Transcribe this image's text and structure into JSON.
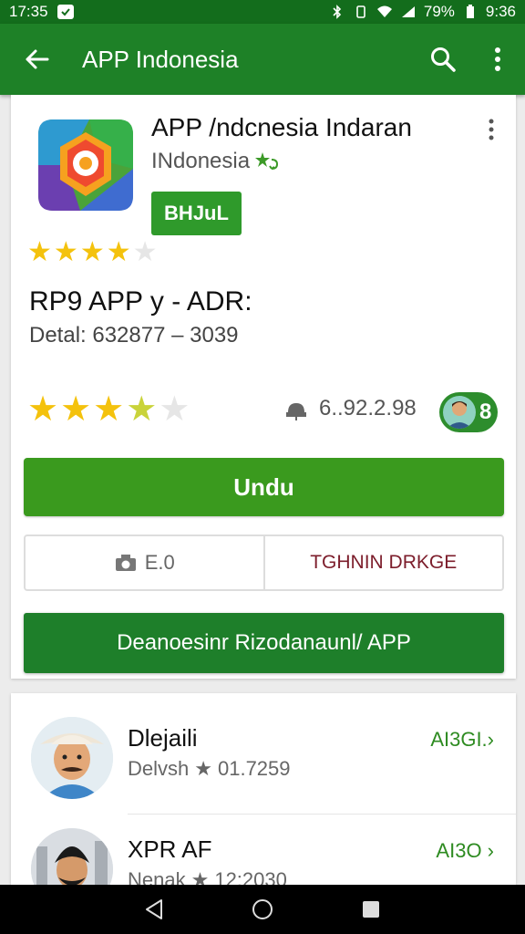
{
  "status_bar": {
    "time": "17:35",
    "battery": "79%",
    "clock_right": "9:36"
  },
  "app_bar": {
    "title": "APP Indonesia"
  },
  "app": {
    "title": "APP /ndcnesia Indaran",
    "developer": "INdonesia",
    "small_button": "BHJuL",
    "top_rating": 4,
    "headline": "RP9 APP y - ADR:",
    "detail": "Detal: 632877 – 3039",
    "rating": 3.5,
    "downloads": "6..92.2.98",
    "badge_count": "8",
    "install_button": "Undu",
    "split_left": "E.0",
    "split_right": "TGHNIN DRKGE",
    "banner_button": "Deanoesinr Rizodanaunl/ APP"
  },
  "list": [
    {
      "name": "Dlejaili",
      "meta_prefix": "Delvsh",
      "meta_value": "01.7259",
      "link": "AI3GI.›"
    },
    {
      "name": "XPR AF",
      "meta_prefix": "Nenak",
      "meta_value": "12:2030",
      "link": "AI3O ›"
    }
  ],
  "colors": {
    "status_bar": "#136d1c",
    "app_bar": "#1e8127",
    "accent": "#3a9a1e",
    "star": "#f4c20d"
  },
  "icons": [
    "back-arrow-icon",
    "search-icon",
    "kebab-icon",
    "star-icon",
    "download-icon",
    "camera-icon",
    "back-triangle-icon",
    "home-circle-icon",
    "recents-square-icon"
  ]
}
